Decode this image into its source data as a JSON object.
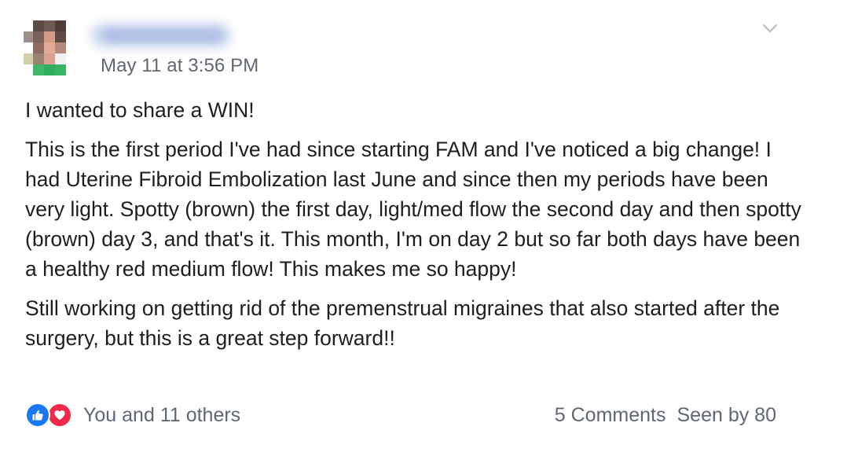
{
  "post": {
    "author_name": "",
    "timestamp": "May 11 at 3:56 PM",
    "paragraphs": [
      "I wanted to share a WIN!",
      "This is the first period I've had since starting FAM and I've noticed a big change! I had Uterine Fibroid Embolization last June and since then my periods have been very light. Spotty (brown) the first day, light/med flow the second day and then spotty (brown) day 3, and that's it. This month, I'm on day 2 but so far both days have been a healthy red medium flow! This makes me so happy!",
      "Still working on getting rid of the premenstrual migraines that also started after the surgery, but this is a great step forward!!"
    ]
  },
  "reactions": {
    "icons": [
      "like-icon",
      "love-icon"
    ],
    "text": "You and 11 others"
  },
  "stats": {
    "comments": "5 Comments",
    "seen": "Seen by 80"
  },
  "menu": {
    "icon": "chevron-down-icon"
  },
  "colors": {
    "like": "#1877f2",
    "love": "#f0284a",
    "secondary_text": "#616770"
  }
}
